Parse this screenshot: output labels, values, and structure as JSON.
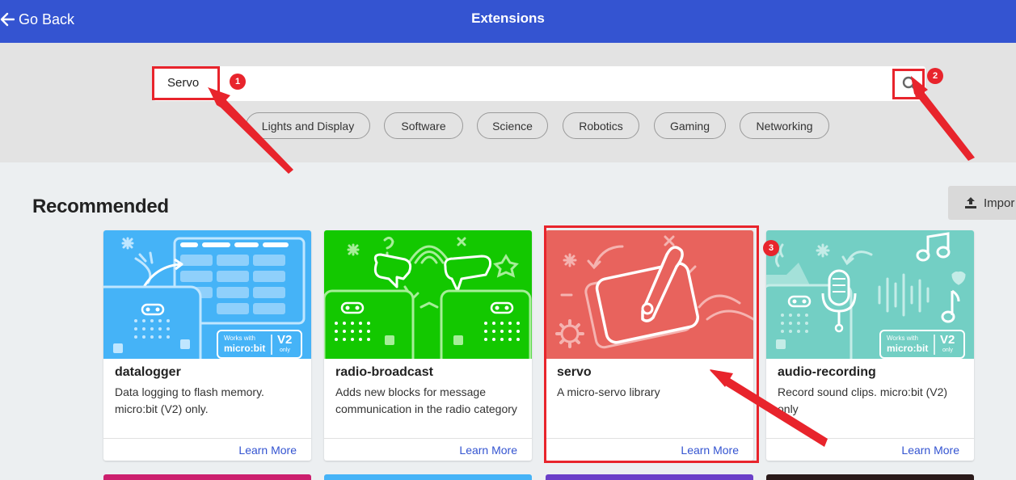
{
  "header": {
    "back_label": "Go Back",
    "title": "Extensions",
    "bg_color": "#3454d1"
  },
  "search": {
    "value": "Servo",
    "icon": "search-icon"
  },
  "categories": [
    "Lights and Display",
    "Software",
    "Science",
    "Robotics",
    "Gaming",
    "Networking"
  ],
  "section": {
    "title": "Recommended",
    "import_label": "Impor",
    "import_icon": "upload-icon"
  },
  "cards": [
    {
      "name": "datalogger",
      "description": "Data logging to flash memory. micro:bit (V2) only.",
      "link": "Learn More",
      "color": "#45b3f7"
    },
    {
      "name": "radio-broadcast",
      "description": "Adds new blocks for message communication in the radio category",
      "link": "Learn More",
      "color": "#13c800"
    },
    {
      "name": "servo",
      "description": "A micro-servo library",
      "link": "Learn More",
      "color": "#e8635d"
    },
    {
      "name": "audio-recording",
      "description": "Record sound clips. micro:bit (V2) only",
      "link": "Learn More",
      "color": "#73cfc4"
    }
  ],
  "badge_text": {
    "works_with": "Works with",
    "microbit": "micro:bit",
    "v2": "V2",
    "only": "only"
  },
  "annotations": {
    "numbers": [
      "1",
      "2",
      "3"
    ],
    "color": "#e8242c"
  }
}
